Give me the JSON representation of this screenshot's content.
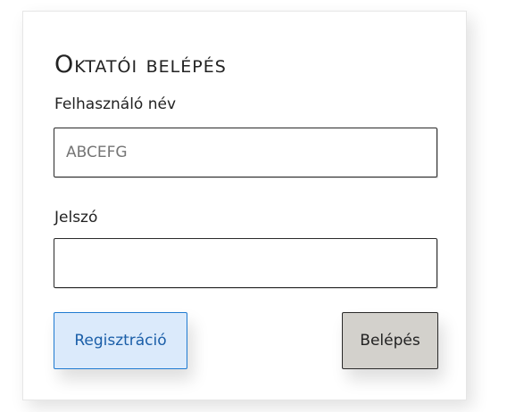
{
  "login_form": {
    "title": "Oktatói belépés",
    "username": {
      "label": "Felhasználó név",
      "placeholder": "ABCEFG",
      "value": ""
    },
    "password": {
      "label": "Jelszó",
      "placeholder": "",
      "value": ""
    },
    "buttons": {
      "register_label": "Regisztráció",
      "login_label": "Belépés"
    }
  },
  "colors": {
    "register_bg": "#dbeafb",
    "register_border": "#1f7ad1",
    "register_text": "#1a5ea8",
    "login_bg": "#d3d1cc"
  }
}
